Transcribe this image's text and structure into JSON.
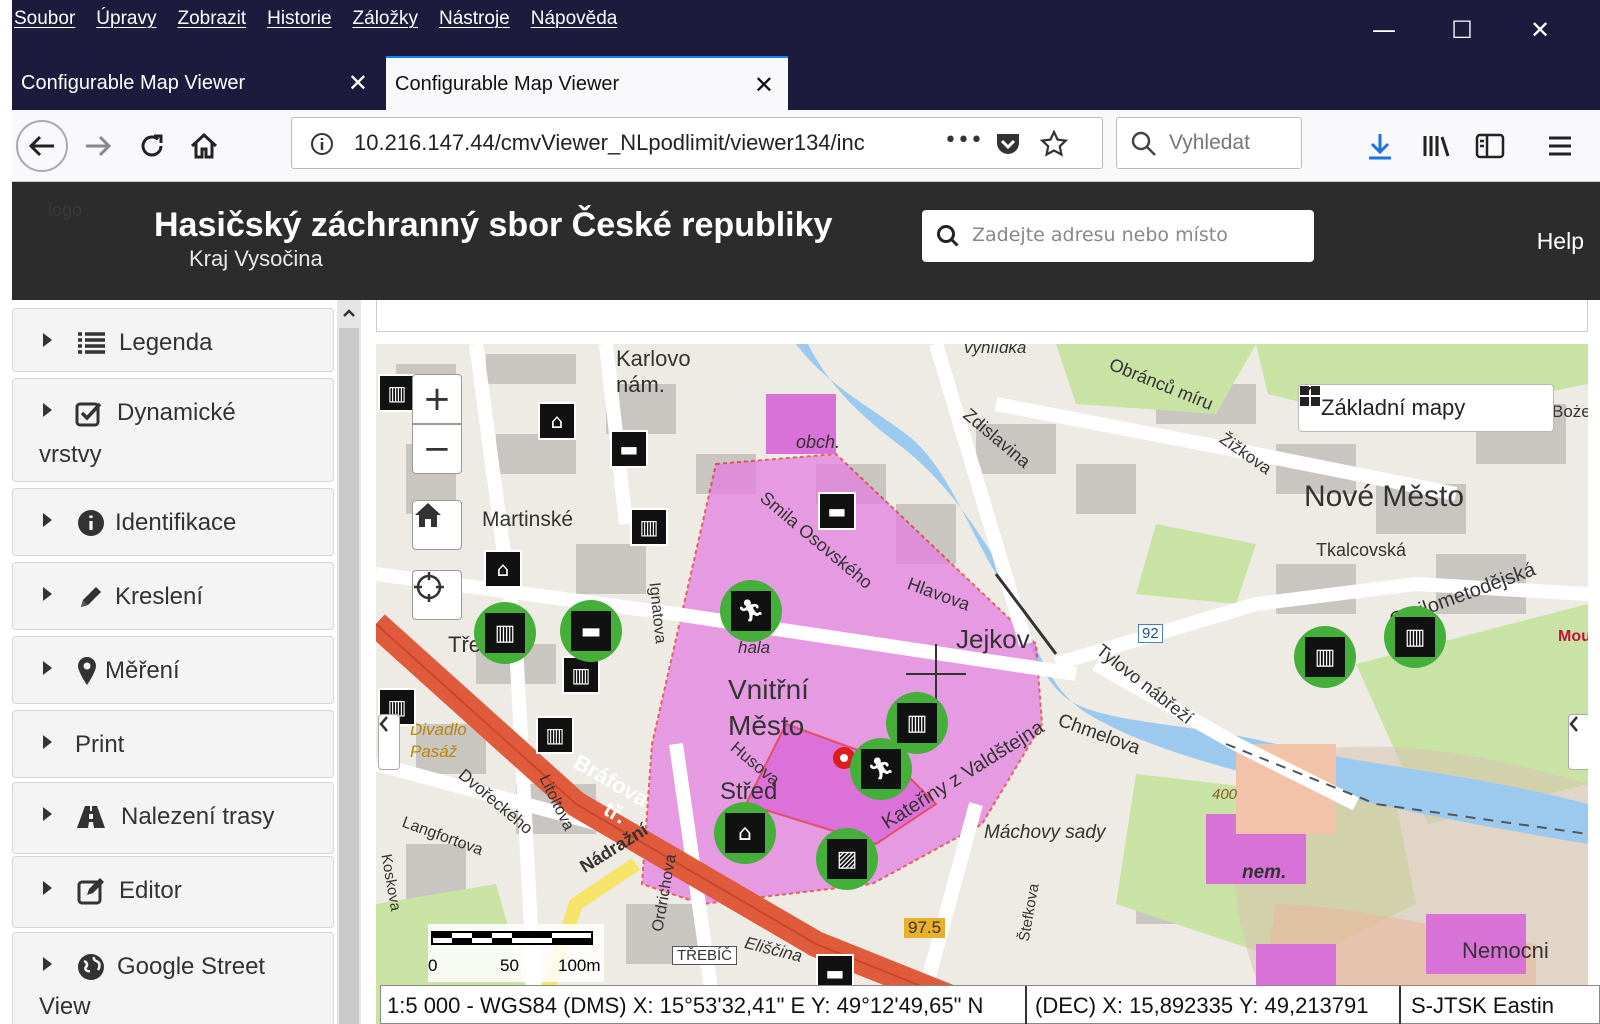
{
  "browser": {
    "menu": [
      "Soubor",
      "Úpravy",
      "Zobrazit",
      "Historie",
      "Záložky",
      "Nástroje",
      "Nápověda"
    ],
    "tabs": [
      {
        "title": "Configurable Map Viewer",
        "close": "✕"
      },
      {
        "title": "Configurable Map Viewer",
        "close": "✕"
      }
    ],
    "url": "10.216.147.44/cmvViewer_NLpodlimit/viewer134/inc",
    "url_dots": "•••",
    "search_placeholder": "Vyhledat",
    "window_controls": {
      "minimize": "—",
      "maximize": "☐",
      "close": "✕"
    },
    "icons": [
      "back-arrow-icon",
      "forward-arrow-icon",
      "reload-icon",
      "home-icon",
      "info-icon",
      "pocket-icon",
      "bookmark-star-icon",
      "search-icon",
      "download-icon",
      "library-icon",
      "sidebar-icon",
      "hamburger-menu-icon"
    ]
  },
  "app": {
    "title": "Hasičský záchranný sbor České republiky",
    "subtitle": "Kraj Vysočina",
    "logo_alt": "logo",
    "search_placeholder": "Zadejte adresu nebo místo",
    "help": "Help",
    "header_bg": "#2d2c2c"
  },
  "sidebar": {
    "panels": [
      {
        "label": "Legenda",
        "icon": "list-icon"
      },
      {
        "label": "Dynamické",
        "label2": "vrstvy",
        "icon": "checkbox-icon"
      },
      {
        "label": "Identifikace",
        "icon": "info-circle-icon"
      },
      {
        "label": "Kreslení",
        "icon": "pencil-icon"
      },
      {
        "label": "Měření",
        "icon": "map-marker-icon"
      },
      {
        "label": "Print",
        "icon": ""
      },
      {
        "label": "Nalezení trasy",
        "icon": "road-icon"
      },
      {
        "label": "Editor",
        "icon": "edit-icon"
      },
      {
        "label": "Google Street",
        "label2": "View",
        "icon": "globe-icon"
      }
    ]
  },
  "map": {
    "basemap_button": "Základní mapy",
    "zoom_in": "+",
    "zoom_out": "−",
    "labels": {
      "karlovo": "Karlovo",
      "nam": "nám.",
      "obch": "obch.",
      "vyhlidka": "vyhlídka",
      "obrancu": "Obránců míru",
      "zdislavina": "Zdislavina",
      "zizkova": "Žižkova",
      "nove_mesto": "Nové Město",
      "tkalcovska": "Tkalcovská",
      "cyrilometodejska": "Cyrilometodějská",
      "smila": "Smila Osovského",
      "hlavova": "Hlavova",
      "jejkov": "Jejkov",
      "vnitrni": "Vnitřní",
      "mesto": "Město",
      "martinske": "Martinské",
      "trebic": "Třebíč",
      "hala": "hala",
      "chmelova": "Chmelova",
      "tylovo": "Tylovo nábřeží",
      "bozetech": "Boże",
      "mou": "Mou",
      "stred": "Střed",
      "husova": "Husova",
      "kateriny": "Kateřiny z Valdštejna",
      "machovy": "Máchovy sady",
      "brafova": "Bráfova",
      "tr": "tř.",
      "nadrazni": "Nádražní",
      "dvoreckeho": "Dvořeckého",
      "litoltova": "Litoltova",
      "langfortova": "Langfortova",
      "divadlo": "Divadlo",
      "pasaz": "Pasáž",
      "elisc": "Eliščina",
      "ordrichova": "Ordrichova",
      "nem": "nem.",
      "nemocnice": "Nemocni",
      "trebic_sign": "TŘEBÍČ",
      "road92": "92",
      "road975": "97.5",
      "alt400": "400",
      "ignatova": "Ignatova",
      "stefkova": "Štefkova",
      "kosl": "Koskova"
    },
    "scale": {
      "t0": "0",
      "t1": "50",
      "t2": "100m"
    },
    "coords": {
      "dms": "1:5 000 - WGS84 (DMS) X: 15°53'32,41\" E  Y: 49°12'49,65\" N",
      "dec": "(DEC) X: 15,892335  Y: 49,213791",
      "sjtsk": "S-JTSK Eastin"
    },
    "colors": {
      "highlight": "#e26ae0",
      "river": "#9dc9ee",
      "park": "#c9e6a8",
      "road_main": "#e05a3c",
      "poi_green": "#44b03a"
    }
  }
}
